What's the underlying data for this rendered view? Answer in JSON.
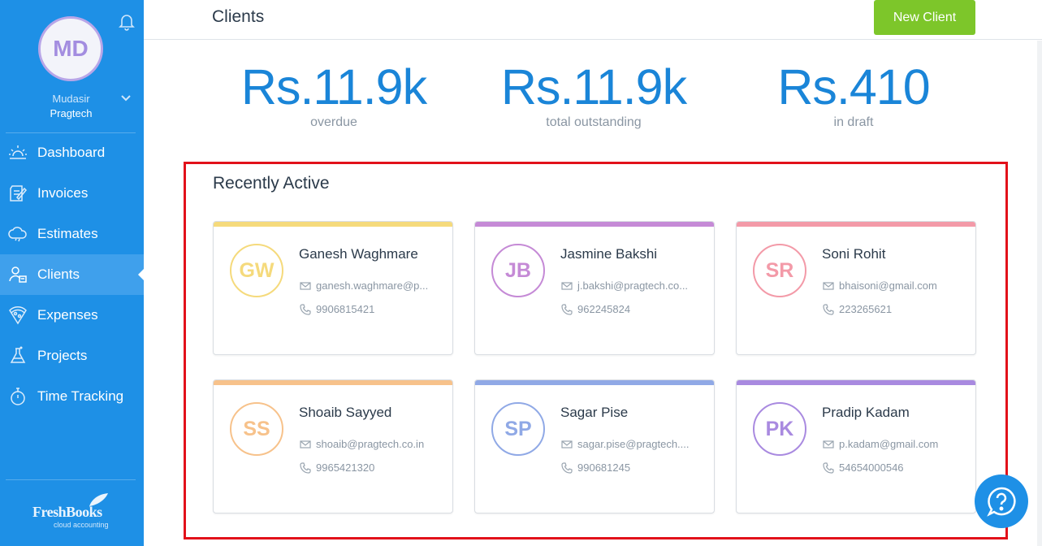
{
  "sidebar": {
    "avatar_initials": "MD",
    "user_name": "Mudasir",
    "user_org": "Pragtech",
    "nav": [
      {
        "label": "Dashboard",
        "icon": "dashboard-icon"
      },
      {
        "label": "Invoices",
        "icon": "invoice-icon"
      },
      {
        "label": "Estimates",
        "icon": "estimate-icon"
      },
      {
        "label": "Clients",
        "icon": "clients-icon",
        "active": true
      },
      {
        "label": "Expenses",
        "icon": "expenses-icon"
      },
      {
        "label": "Projects",
        "icon": "projects-icon"
      },
      {
        "label": "Time Tracking",
        "icon": "stopwatch-icon"
      }
    ],
    "logo": {
      "main": "FreshBooks",
      "sub": "cloud accounting"
    }
  },
  "header": {
    "title": "Clients",
    "new_client_label": "New Client"
  },
  "summary": [
    {
      "value": "Rs.11.9k",
      "label": "overdue"
    },
    {
      "value": "Rs.11.9k",
      "label": "total outstanding"
    },
    {
      "value": "Rs.410",
      "label": "in draft"
    }
  ],
  "recent": {
    "title": "Recently Active",
    "clients": [
      {
        "initials": "GW",
        "name": "Ganesh Waghmare",
        "email": "ganesh.waghmare@p...",
        "phone": "9906815421",
        "color": "#f5da7c"
      },
      {
        "initials": "JB",
        "name": "Jasmine Bakshi",
        "email": "j.bakshi@pragtech.co...",
        "phone": "962245824",
        "color": "#c58ad6"
      },
      {
        "initials": "SR",
        "name": "Soni Rohit",
        "email": "bhaisoni@gmail.com",
        "phone": "223265621",
        "color": "#f39aa8"
      },
      {
        "initials": "SS",
        "name": "Shoaib Sayyed",
        "email": "shoaib@pragtech.co.in",
        "phone": "9965421320",
        "color": "#f7c28b"
      },
      {
        "initials": "SP",
        "name": "Sagar Pise",
        "email": "sagar.pise@pragtech....",
        "phone": "990681245",
        "color": "#90a9e6"
      },
      {
        "initials": "PK",
        "name": "Pradip Kadam",
        "email": "p.kadam@gmail.com",
        "phone": "54654000546",
        "color": "#a98ae0"
      }
    ]
  },
  "colors": {
    "sidebar": "#1e90e6",
    "accent": "#1a85d8",
    "primary_button": "#7dc62a",
    "highlight": "#e2111a"
  }
}
